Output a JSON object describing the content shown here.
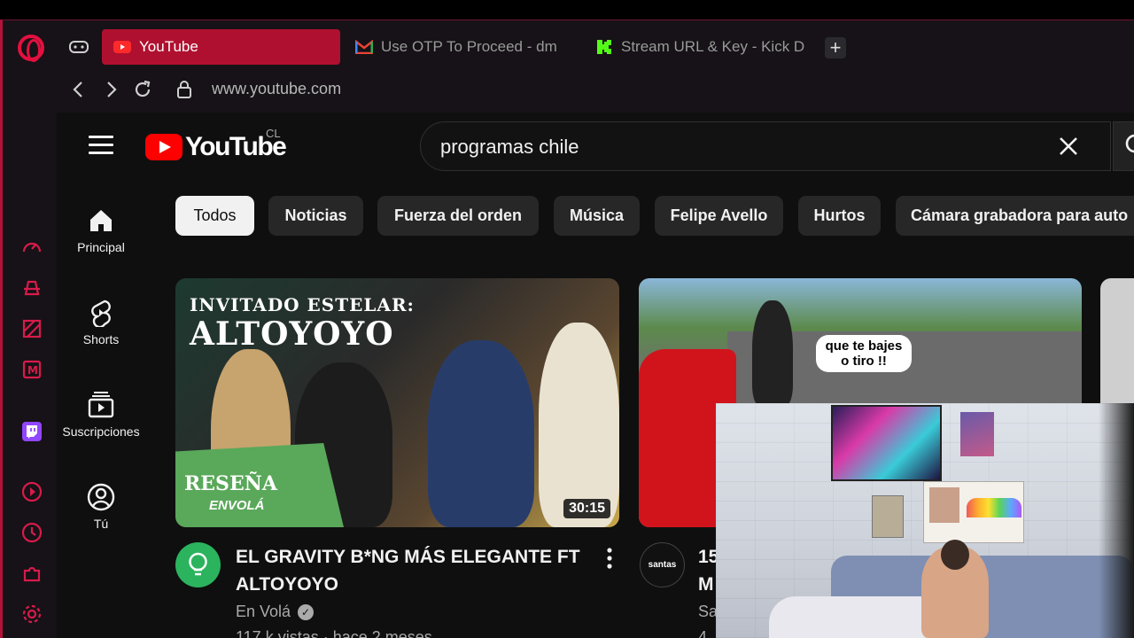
{
  "browser": {
    "tabs": [
      {
        "label": "YouTube",
        "active": true
      },
      {
        "label": "Use OTP To Proceed - dm",
        "active": false
      },
      {
        "label": "Stream URL & Key - Kick D",
        "active": false
      }
    ],
    "new_tab_label": "+",
    "url": "www.youtube.com",
    "accent": "#b0102f"
  },
  "youtube": {
    "logo_text": "YouTube",
    "country_code": "CL",
    "search": {
      "value": "programas chile"
    },
    "sidebar": [
      {
        "label": "Principal",
        "icon": "home-icon"
      },
      {
        "label": "Shorts",
        "icon": "shorts-icon"
      },
      {
        "label": "Suscripciones",
        "icon": "subscriptions-icon"
      },
      {
        "label": "Tú",
        "icon": "user-icon"
      }
    ],
    "chips": [
      "Todos",
      "Noticias",
      "Fuerza del orden",
      "Música",
      "Felipe Avello",
      "Hurtos",
      "Cámara grabadora para auto"
    ],
    "videos": [
      {
        "thumb_line1": "INVITADO ESTELAR:",
        "thumb_line2": "ALTOYOYO",
        "badge_line1": "RESEÑA",
        "badge_line2": "ENVOLÁ",
        "duration": "30:15",
        "title": "EL GRAVITY B*NG MÁS ELEGANTE FT ALTOYOYO",
        "channel": "En Volá",
        "meta": "117 k vistas · hace 2 meses"
      },
      {
        "thumb_bubble": "que te bajes o tiro !!",
        "avatar_text": "santas",
        "title": "15",
        "title_line2": "M",
        "channel": "Sa",
        "meta": "4"
      }
    ]
  }
}
